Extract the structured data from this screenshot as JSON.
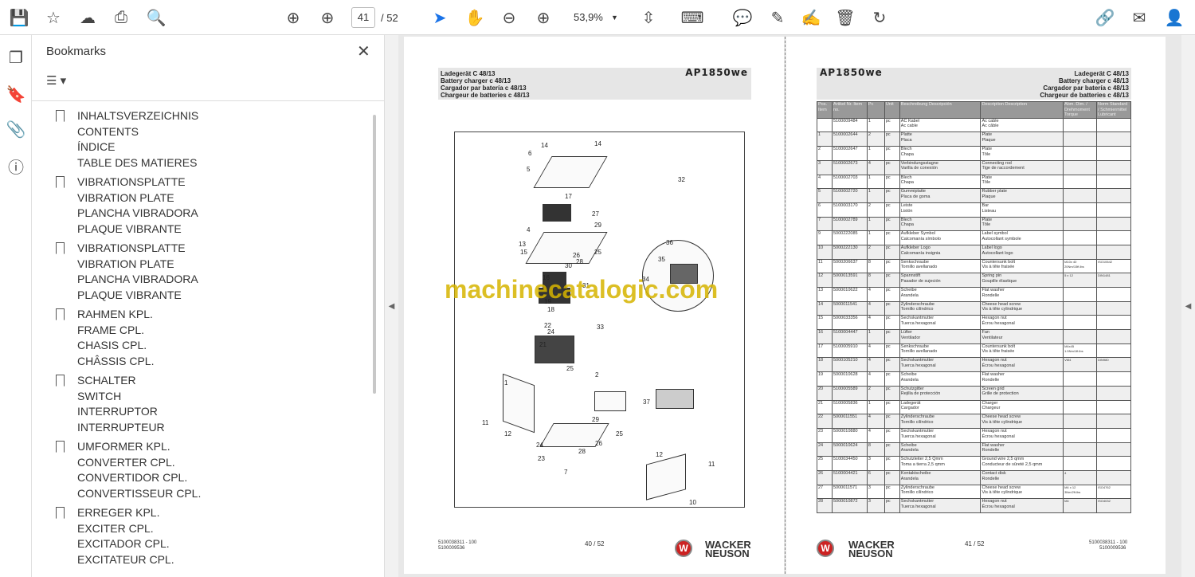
{
  "toolbar": {
    "page_current": "41",
    "page_total": "/ 52",
    "zoom": "53,9%"
  },
  "bookmarks": {
    "title": "Bookmarks",
    "close": "✕",
    "options": "☰ ▾",
    "groups": [
      [
        "INHALTSVERZEICHNIS",
        "CONTENTS",
        "ÍNDICE",
        "TABLE DES MATIERES"
      ],
      [
        "VIBRATIONSPLATTE",
        "VIBRATION PLATE",
        "PLANCHA VIBRADORA",
        "PLAQUE VIBRANTE"
      ],
      [
        "VIBRATIONSPLATTE",
        "VIBRATION PLATE",
        "PLANCHA VIBRADORA",
        "PLAQUE VIBRANTE"
      ],
      [
        "RAHMEN KPL.",
        "FRAME CPL.",
        "CHASIS CPL.",
        "CHÂSSIS CPL."
      ],
      [
        "SCHALTER",
        "SWITCH",
        "INTERRUPTOR",
        "INTERRUPTEUR"
      ],
      [
        "UMFORMER KPL.",
        "CONVERTER CPL.",
        "CONVERTIDOR CPL.",
        "CONVERTISSEUR CPL."
      ],
      [
        "ERREGER KPL.",
        "EXCITER CPL.",
        "EXCITADOR CPL.",
        "EXCITATEUR CPL."
      ]
    ]
  },
  "doc": {
    "model": "AP1850we",
    "titles": [
      "Ladegerät C 48/13",
      "Battery charger c 48/13",
      "Cargador par batería c 48/13",
      "Chargeur de batteries c 48/13"
    ],
    "watermark": "machinecatalogic.com",
    "left_footer": {
      "docno": "5100038311 - 100",
      "docno2": "5100009536",
      "page": "40 / 52"
    },
    "right_footer": {
      "docno": "5100038311 - 100",
      "docno2": "5100009536",
      "page": "41 / 52"
    },
    "brand": [
      "WACKER",
      "NEUSON"
    ],
    "callouts": [
      "14",
      "6",
      "14",
      "5",
      "32",
      "17",
      "27",
      "29",
      "4",
      "13",
      "15",
      "25",
      "26",
      "28",
      "30",
      "36",
      "35",
      "16",
      "31",
      "34",
      "19",
      "18",
      "33",
      "22",
      "24",
      "21",
      "25",
      "2",
      "37",
      "1",
      "11",
      "12",
      "29",
      "24",
      "26",
      "25",
      "23",
      "28",
      "7",
      "12",
      "11",
      "10"
    ],
    "table_headers": [
      "Pos. Item",
      "Artikel Nr. Item no.",
      "Pc",
      "Unit",
      "Beschreibung Descripción",
      "Description Description",
      "Abm. Dim. / Drehmoment Torque",
      "Norm Standard / Schmiermittel Lubricant"
    ],
    "rows": [
      [
        "",
        "5100009484",
        "1",
        "pc",
        "AC Kabel\nAc cable",
        "Ac cable\nAc câble",
        "",
        ""
      ],
      [
        "1",
        "5100002644",
        "2",
        "pc",
        "Platte\nPlaca",
        "Plate\nPlaque",
        "",
        ""
      ],
      [
        "2",
        "5100002647",
        "1",
        "pc",
        "Blech\nChapa",
        "Plate\nTôle",
        "",
        ""
      ],
      [
        "3",
        "5100002673",
        "4",
        "pc",
        "Verbindungsstagne\nVarilla de conexión",
        "Connecting rod\nTige de raccordement",
        "",
        ""
      ],
      [
        "4",
        "5100002703",
        "1",
        "pc",
        "Blech\nChapa",
        "Plate\nTôle",
        "",
        ""
      ],
      [
        "5",
        "5100002720",
        "1",
        "pc",
        "Gummiplatte\nPlaca de goma",
        "Rubber plate\nPlaque",
        "",
        ""
      ],
      [
        "6",
        "5100003170",
        "2",
        "pc",
        "Leiste\nListón",
        "Bar\nListeau",
        "",
        ""
      ],
      [
        "7",
        "5100002789",
        "1",
        "pc",
        "Blech\nChapa",
        "Plate\nTôle",
        "",
        ""
      ],
      [
        "9",
        "5000222085",
        "1",
        "pc",
        "Aufkleber Symbol\nCalcomanía símbolo",
        "Label symbol\nAutocollant symbole",
        "",
        ""
      ],
      [
        "10",
        "5000222130",
        "2",
        "pc",
        "Aufkleber Logo\nCalcomanía insignia",
        "Label logo\nAutocollant logo",
        "",
        ""
      ],
      [
        "11",
        "5000206637",
        "8",
        "pc",
        "Senkschraube\nTornillo avellanado",
        "Countersunk bolt\nVis à tête fraisée",
        "M10x 40\n20Nm/15ft.lbs",
        "ISO10642"
      ],
      [
        "12",
        "5000013591",
        "8",
        "pc",
        "Spannstift\nPasador de sujeción",
        "Spring pin\nGoupille élastique",
        "5 x 12",
        "DIN1481"
      ],
      [
        "13",
        "5000010622",
        "4",
        "pc",
        "Scheibe\nArandela",
        "Flat washer\nRondelle",
        "",
        ""
      ],
      [
        "14",
        "5000011541",
        "4",
        "pc",
        "Zylinderschraube\nTornillo cilíndrico",
        "Cheese head screw\nVis à tête cylindrique",
        "",
        ""
      ],
      [
        "15",
        "5000033356",
        "4",
        "pc",
        "Sechskantmutter\nTuerca hexagonal",
        "Hexagon nut\nÉcrou hexagonal",
        "",
        ""
      ],
      [
        "16",
        "5100004447",
        "1",
        "pc",
        "Lüfter\nVentilador",
        "Fan\nVentilateur",
        "",
        ""
      ],
      [
        "17",
        "5100005910",
        "4",
        "pc",
        "Senkschraube\nTornillo avellanado",
        "Countersunk bolt\nVis à tête fraisée",
        "M4x45\n1.5Nm/1ft.lbs",
        ""
      ],
      [
        "18",
        "5000105210",
        "4",
        "pc",
        "Sechskantmutter\nTuerca hexagonal",
        "Hexagon nut\nÉcrou hexagonal",
        "VM4",
        "DIN980"
      ],
      [
        "19",
        "5000010628",
        "4",
        "pc",
        "Scheibe\nArandela",
        "Flat washer\nRondelle",
        "",
        ""
      ],
      [
        "20",
        "5100005589",
        "2",
        "pc",
        "Schutzgitter\nRejilla de protección",
        "Screen grid\nGrille de protection",
        "",
        ""
      ],
      [
        "21",
        "5100005836",
        "1",
        "pc",
        "Ladegerät\nCargador",
        "Charger\nChargeur",
        "",
        ""
      ],
      [
        "22",
        "5000011551",
        "4",
        "pc",
        "Zylinderschraube\nTornillo cilíndrico",
        "Cheese head screw\nVis à tête cylindrique",
        "",
        ""
      ],
      [
        "23",
        "5000010880",
        "4",
        "pc",
        "Sechskantmutter\nTuerca hexagonal",
        "Hexagon nut\nÉcrou hexagonal",
        "",
        ""
      ],
      [
        "24",
        "5000010624",
        "8",
        "pc",
        "Scheibe\nArandela",
        "Flat washer\nRondelle",
        "",
        ""
      ],
      [
        "25",
        "5100034450",
        "3",
        "pc",
        "Schutzleiter 2,5 Qmm\nToma a tierra 2,5 qmm",
        "Ground wire 2,5 qmm\nConducteur de sûreté 2,5 qmm",
        "",
        ""
      ],
      [
        "26",
        "5100004421",
        "6",
        "pc",
        "Kontaktscheibe\nArandela",
        "Contact disk\nRondelle",
        "4",
        ""
      ],
      [
        "27",
        "5000011571",
        "3",
        "pc",
        "Zylinderschraube\nTornillo cilíndrico",
        "Cheese head screw\nVis à tête cylindrique",
        "M4 x 12\n3Nm/2ft.lbs",
        "ISO4762"
      ],
      [
        "28",
        "5000010872",
        "3",
        "pc",
        "Sechskantmutter\nTuerca hexagonal",
        "Hexagon nut\nÉcrou hexagonal",
        "M4",
        "ISO4032"
      ]
    ]
  }
}
